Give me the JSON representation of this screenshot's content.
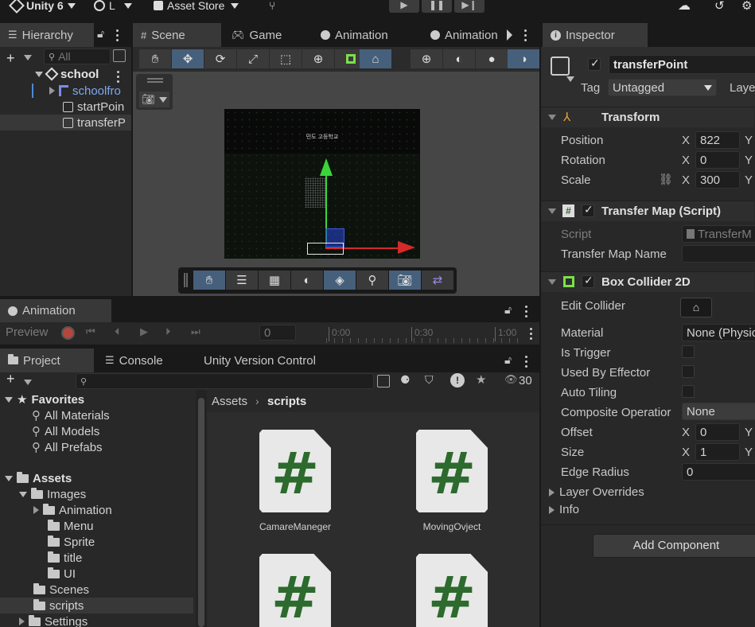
{
  "topbar": {
    "app_title": "Unity 6",
    "account_initial": "L",
    "asset_store": "Asset Store"
  },
  "hierarchy": {
    "tab": "Hierarchy",
    "search_placeholder": "All",
    "scene_name": "school",
    "items": [
      "schoolfro",
      "startPoin",
      "transferP"
    ]
  },
  "scene_tabs": {
    "scene": "Scene",
    "game": "Game",
    "animation": "Animation",
    "animator": "Animation"
  },
  "scene_view": {
    "korean_label": "민도 고등학교"
  },
  "animation_panel": {
    "tab": "Animation",
    "preview": "Preview",
    "frame": "0",
    "time_marks": [
      "0:00",
      "0:30",
      "1:00"
    ]
  },
  "project": {
    "tabs": [
      "Project",
      "Console",
      "Unity Version Control"
    ],
    "count": "30",
    "favorites_label": "Favorites",
    "favorites": [
      "All Materials",
      "All Models",
      "All Prefabs"
    ],
    "assets_label": "Assets",
    "images_label": "Images",
    "images_children": [
      "Animation",
      "Menu",
      "Sprite",
      "title",
      "UI"
    ],
    "scenes": "Scenes",
    "scripts": "scripts",
    "settings": "Settings",
    "breadcrumb_root": "Assets",
    "breadcrumb_current": "scripts",
    "files": [
      "CamareManeger",
      "MovingOvject"
    ]
  },
  "inspector": {
    "tab": "Inspector",
    "object_name": "transferPoint",
    "tag_label": "Tag",
    "tag_value": "Untagged",
    "layer_label": "Laye",
    "transform": {
      "title": "Transform",
      "position_label": "Position",
      "rotation_label": "Rotation",
      "scale_label": "Scale",
      "axis": "X",
      "axis_y": "Y",
      "position_x": "822",
      "rotation_x": "0",
      "scale_x": "300"
    },
    "transfer_map": {
      "title": "Transfer Map (Script)",
      "script_label": "Script",
      "script_value": "TransferM",
      "name_label": "Transfer Map Name",
      "name_value": ""
    },
    "box_collider": {
      "title": "Box Collider 2D",
      "edit_collider": "Edit Collider",
      "material_label": "Material",
      "material_value": "None (Physic",
      "is_trigger": "Is Trigger",
      "used_by_effector": "Used By Effector",
      "auto_tiling": "Auto Tiling",
      "composite_label": "Composite Operatior",
      "composite_value": "None",
      "offset_label": "Offset",
      "offset_x": "0",
      "size_label": "Size",
      "size_x": "1",
      "edge_radius_label": "Edge Radius",
      "edge_radius_value": "0",
      "layer_overrides": "Layer Overrides",
      "info": "Info"
    },
    "add_component": "Add Component"
  },
  "colors": {
    "accent_blue": "#46607c",
    "green_gizmo": "#3bd43b",
    "red_gizmo": "#d42a2a"
  }
}
